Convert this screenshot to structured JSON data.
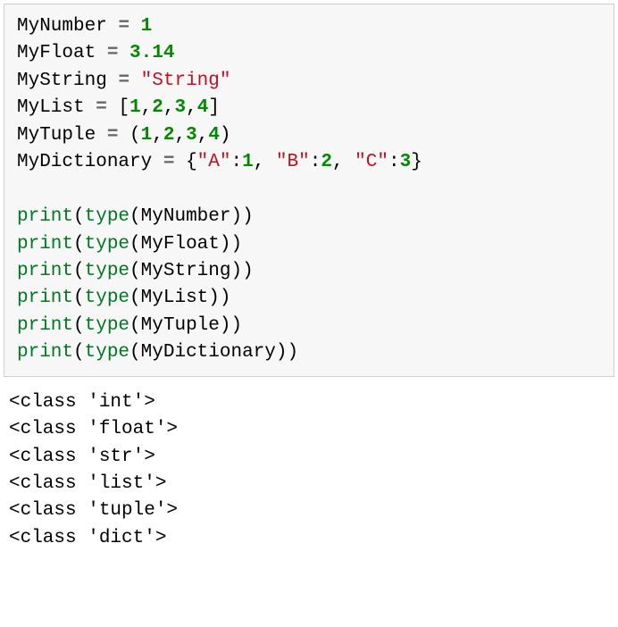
{
  "code": {
    "line1": {
      "var": "MyNumber",
      "eq": "=",
      "val": "1"
    },
    "line2": {
      "var": "MyFloat",
      "eq": "=",
      "val": "3.14"
    },
    "line3": {
      "var": "MyString",
      "eq": "=",
      "val": "\"String\""
    },
    "line4": {
      "var": "MyList",
      "eq": "=",
      "lb": "[",
      "n1": "1",
      "c1": ",",
      "n2": "2",
      "c2": ",",
      "n3": "3",
      "c3": ",",
      "n4": "4",
      "rb": "]"
    },
    "line5": {
      "var": "MyTuple",
      "eq": "=",
      "lp": "(",
      "n1": "1",
      "c1": ",",
      "n2": "2",
      "c2": ",",
      "n3": "3",
      "c3": ",",
      "n4": "4",
      "rp": ")"
    },
    "line6": {
      "var": "MyDictionary",
      "eq": "=",
      "lb": "{",
      "k1": "\"A\"",
      "col1": ":",
      "v1": "1",
      "c1": ",",
      "sp1": " ",
      "k2": "\"B\"",
      "col2": ":",
      "v2": "2",
      "c2": ",",
      "sp2": " ",
      "k3": "\"C\"",
      "col3": ":",
      "v3": "3",
      "rb": "}"
    },
    "blank": "",
    "print_lines": {
      "p1": {
        "print": "print",
        "lp": "(",
        "type": "type",
        "lp2": "(",
        "arg": "MyNumber",
        "rp2": ")",
        "rp": ")"
      },
      "p2": {
        "print": "print",
        "lp": "(",
        "type": "type",
        "lp2": "(",
        "arg": "MyFloat",
        "rp2": ")",
        "rp": ")"
      },
      "p3": {
        "print": "print",
        "lp": "(",
        "type": "type",
        "lp2": "(",
        "arg": "MyString",
        "rp2": ")",
        "rp": ")"
      },
      "p4": {
        "print": "print",
        "lp": "(",
        "type": "type",
        "lp2": "(",
        "arg": "MyList",
        "rp2": ")",
        "rp": ")"
      },
      "p5": {
        "print": "print",
        "lp": "(",
        "type": "type",
        "lp2": "(",
        "arg": "MyTuple",
        "rp2": ")",
        "rp": ")"
      },
      "p6": {
        "print": "print",
        "lp": "(",
        "type": "type",
        "lp2": "(",
        "arg": "MyDictionary",
        "rp2": ")",
        "rp": ")"
      }
    }
  },
  "output": {
    "l1": "<class 'int'>",
    "l2": "<class 'float'>",
    "l3": "<class 'str'>",
    "l4": "<class 'list'>",
    "l5": "<class 'tuple'>",
    "l6": "<class 'dict'>"
  }
}
